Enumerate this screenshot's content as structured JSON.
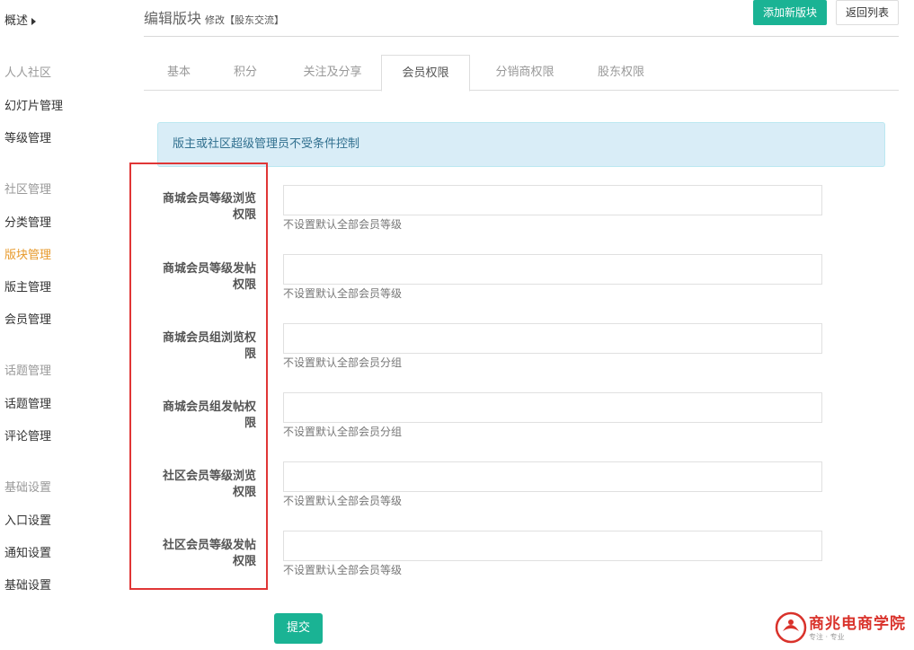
{
  "sidebar": {
    "overview": "概述",
    "groups": [
      {
        "title": "人人社区",
        "items": [
          "幻灯片管理",
          "等级管理"
        ]
      },
      {
        "title": "社区管理",
        "items": [
          "分类管理",
          "版块管理",
          "版主管理",
          "会员管理"
        ]
      },
      {
        "title": "话题管理",
        "items": [
          "话题管理",
          "评论管理"
        ]
      },
      {
        "title": "基础设置",
        "items": [
          "入口设置",
          "通知设置",
          "基础设置"
        ]
      }
    ],
    "active_item": "版块管理"
  },
  "header": {
    "title": "编辑版块",
    "subtitle": "修改【股东交流】",
    "add_button": "添加新版块",
    "back_button": "返回列表"
  },
  "tabs": [
    {
      "label": "基本"
    },
    {
      "label": "积分"
    },
    {
      "label": "关注及分享"
    },
    {
      "label": "会员权限"
    },
    {
      "label": "分销商权限"
    },
    {
      "label": "股东权限"
    }
  ],
  "active_tab": "会员权限",
  "alert": "版主或社区超级管理员不受条件控制",
  "form": {
    "fields": [
      {
        "label": "商城会员等级浏览权限",
        "value": "",
        "help": "不设置默认全部会员等级"
      },
      {
        "label": "商城会员等级发帖权限",
        "value": "",
        "help": "不设置默认全部会员等级"
      },
      {
        "label": "商城会员组浏览权限",
        "value": "",
        "help": "不设置默认全部会员分组"
      },
      {
        "label": "商城会员组发帖权限",
        "value": "",
        "help": "不设置默认全部会员分组"
      },
      {
        "label": "社区会员等级浏览权限",
        "value": "",
        "help": "不设置默认全部会员等级"
      },
      {
        "label": "社区会员等级发帖权限",
        "value": "",
        "help": "不设置默认全部会员等级"
      }
    ],
    "submit": "提交"
  },
  "watermark": {
    "name": "商兆电商学院",
    "tagline": "专注 · 专业"
  },
  "colors": {
    "primary": "#1ab394",
    "active_menu": "#e79a2c",
    "highlight_box": "#e03636",
    "alert_bg": "#d9edf7"
  }
}
